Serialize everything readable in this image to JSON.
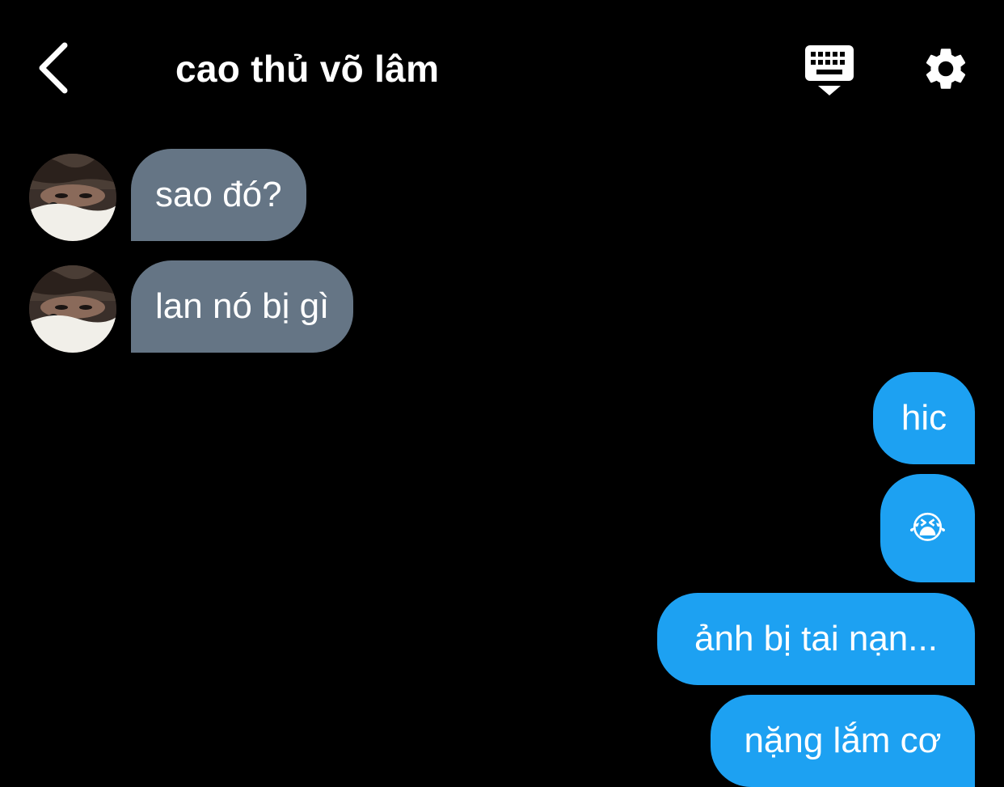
{
  "header": {
    "title": "cao thủ võ lâm",
    "back_icon": "chevron-left-icon",
    "keyboard_icon": "keyboard-hide-icon",
    "settings_icon": "gear-icon"
  },
  "messages": [
    {
      "sender": "other",
      "text": "sao đó?"
    },
    {
      "sender": "other",
      "text": "lan nó bị gì"
    },
    {
      "sender": "me",
      "text": "hic"
    },
    {
      "sender": "me",
      "text": "😭"
    },
    {
      "sender": "me",
      "text": "ảnh bị tai nạn..."
    },
    {
      "sender": "me",
      "text": "nặng lắm cơ"
    }
  ],
  "colors": {
    "background": "#000000",
    "incoming_bubble": "#657585",
    "outgoing_bubble": "#1da1f2",
    "text": "#ffffff"
  }
}
